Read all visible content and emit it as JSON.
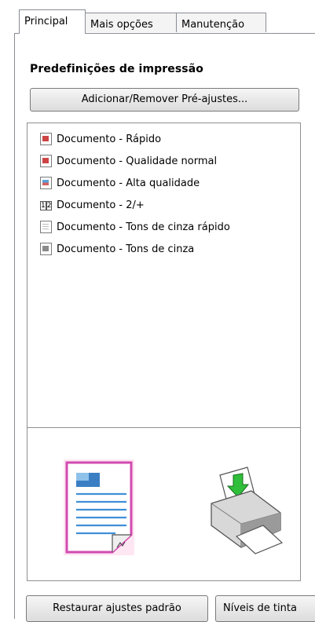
{
  "tabs": [
    {
      "label": "Principal"
    },
    {
      "label": "Mais opções"
    },
    {
      "label": "Manutenção"
    }
  ],
  "presets": {
    "heading": "Predefinições de impressão",
    "add_remove_label": "Adicionar/Remover Pré-ajustes...",
    "items": [
      {
        "label": "Documento - Rápido",
        "icon": "document-fast-icon"
      },
      {
        "label": "Documento - Qualidade normal",
        "icon": "document-normal-icon"
      },
      {
        "label": "Documento - Alta qualidade",
        "icon": "document-high-quality-icon"
      },
      {
        "label": "Documento - 2/+",
        "icon": "two-pages-icon"
      },
      {
        "label": "Documento - Tons de cinza rápido",
        "icon": "document-grayscale-fast-icon"
      },
      {
        "label": "Documento - Tons de cinza",
        "icon": "document-grayscale-icon"
      }
    ]
  },
  "footer": {
    "restore_label": "Restaurar ajustes padrão",
    "ink_levels_label": "Níveis de tinta"
  }
}
